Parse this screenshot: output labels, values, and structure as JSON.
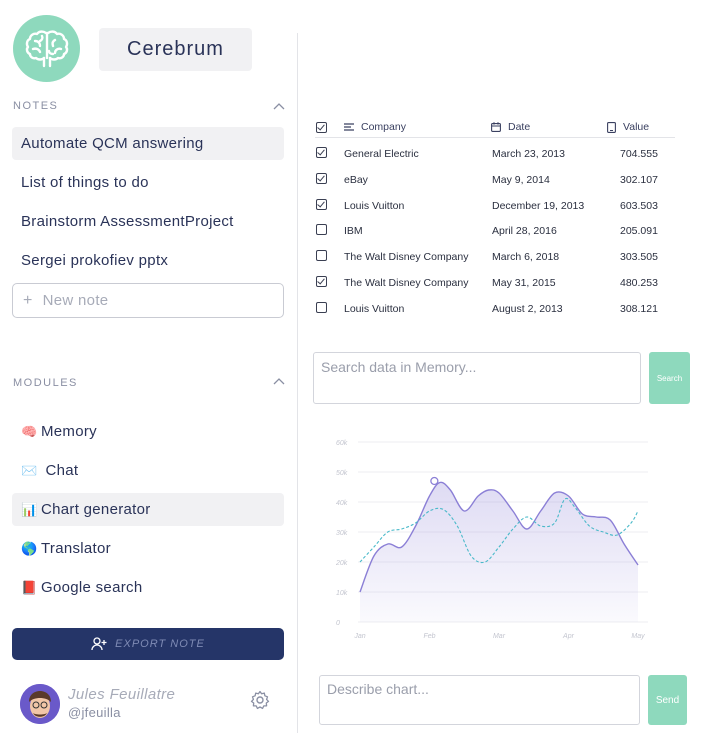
{
  "app": {
    "name": "Cerebrum"
  },
  "notes": {
    "title": "NOTES",
    "items": [
      {
        "label": "Automate QCM answering",
        "active": true
      },
      {
        "label": "List of things to do",
        "active": false
      },
      {
        "label": "Brainstorm AssessmentProject",
        "active": false
      },
      {
        "label": "Sergei prokofiev pptx",
        "active": false
      }
    ],
    "new_note_placeholder": "New note"
  },
  "modules": {
    "title": "MODULES",
    "items": [
      {
        "icon": "🧠",
        "label": "Memory",
        "active": false
      },
      {
        "icon": "✉️",
        "label": " Chat",
        "active": false
      },
      {
        "icon": "📊",
        "label": "Chart generator",
        "active": true
      },
      {
        "icon": "🌎",
        "label": "Translator",
        "active": false
      },
      {
        "icon": "📕",
        "label": "Google search",
        "active": false
      }
    ]
  },
  "export_label": "EXPORT NOTE",
  "user": {
    "name": "Jules Feuillatre",
    "handle": "@jfeuilla"
  },
  "table": {
    "columns": [
      "Company",
      "Date",
      "Value"
    ],
    "rows": [
      {
        "checked": true,
        "company": "General Electric",
        "date": "March 23, 2013",
        "value": "704.555"
      },
      {
        "checked": true,
        "company": "eBay",
        "date": "May 9, 2014",
        "value": "302.107"
      },
      {
        "checked": true,
        "company": "Louis Vuitton",
        "date": "December 19, 2013",
        "value": "603.503"
      },
      {
        "checked": false,
        "company": "IBM",
        "date": "April 28, 2016",
        "value": "205.091"
      },
      {
        "checked": false,
        "company": "The Walt Disney Company",
        "date": "March 6, 2018",
        "value": "303.505"
      },
      {
        "checked": true,
        "company": "The Walt Disney Company",
        "date": "May 31, 2015",
        "value": "480.253"
      },
      {
        "checked": false,
        "company": "Louis Vuitton",
        "date": "August 2, 2013",
        "value": "308.121"
      }
    ]
  },
  "search": {
    "placeholder": "Search data in Memory...",
    "button": "Search"
  },
  "describe": {
    "placeholder": "Describe chart...",
    "button": "Send"
  },
  "chart_data": {
    "type": "area",
    "title": "",
    "xlabel": "",
    "ylabel": "",
    "categories": [
      "Jan",
      "Feb",
      "Mar",
      "Apr",
      "May"
    ],
    "y_ticks": [
      "0",
      "10k",
      "20k",
      "30k",
      "40k",
      "50k",
      "60k"
    ],
    "ylim": [
      0,
      60000
    ],
    "grid": true,
    "colors": {
      "area": "#8b7fd6",
      "dashed": "#49b9c9"
    },
    "series": [
      {
        "style": "area",
        "x": [
          0,
          0.2,
          0.4,
          0.6,
          0.8,
          1.0,
          1.15,
          1.3,
          1.5,
          1.7,
          1.85,
          2.0,
          2.2,
          2.4,
          2.6,
          2.8,
          3.0,
          3.2,
          3.4,
          3.6,
          3.8,
          4.0
        ],
        "values": [
          10000,
          22000,
          26000,
          25000,
          32000,
          42000,
          46500,
          44000,
          37000,
          42000,
          44000,
          43000,
          37000,
          31000,
          37000,
          43000,
          42000,
          36000,
          35000,
          34000,
          26000,
          19000
        ]
      },
      {
        "style": "dashed",
        "x": [
          0,
          0.2,
          0.4,
          0.6,
          0.8,
          1.0,
          1.2,
          1.4,
          1.6,
          1.8,
          2.0,
          2.2,
          2.4,
          2.6,
          2.8,
          2.95,
          3.1,
          3.3,
          3.5,
          3.7,
          3.9,
          4.0
        ],
        "values": [
          20000,
          25000,
          30000,
          31000,
          33000,
          37000,
          37500,
          32000,
          22000,
          20000,
          25000,
          31000,
          35000,
          32000,
          33000,
          41000,
          38000,
          32000,
          30000,
          29000,
          33000,
          37000
        ]
      }
    ],
    "highlight": {
      "x": 1.07,
      "value": 47000
    }
  }
}
